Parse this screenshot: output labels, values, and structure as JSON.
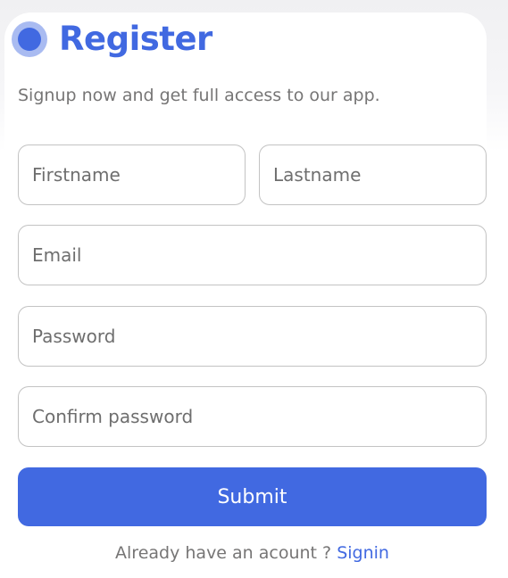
{
  "form": {
    "title": "Register",
    "subtitle": "Signup now and get full access to our app.",
    "fields": {
      "firstname": {
        "placeholder": "Firstname",
        "value": ""
      },
      "lastname": {
        "placeholder": "Lastname",
        "value": ""
      },
      "email": {
        "placeholder": "Email",
        "value": ""
      },
      "password": {
        "placeholder": "Password",
        "value": ""
      },
      "confirm_password": {
        "placeholder": "Confirm password",
        "value": ""
      }
    },
    "submit_label": "Submit",
    "footer_text": "Already have an acount ? ",
    "signin_link": "Signin"
  },
  "colors": {
    "accent": "#4169e1",
    "text_muted": "#585757",
    "border": "#bdbdbd",
    "background": "#ffffff"
  },
  "icons": {
    "title_marker": "pulsing-dot-icon"
  }
}
